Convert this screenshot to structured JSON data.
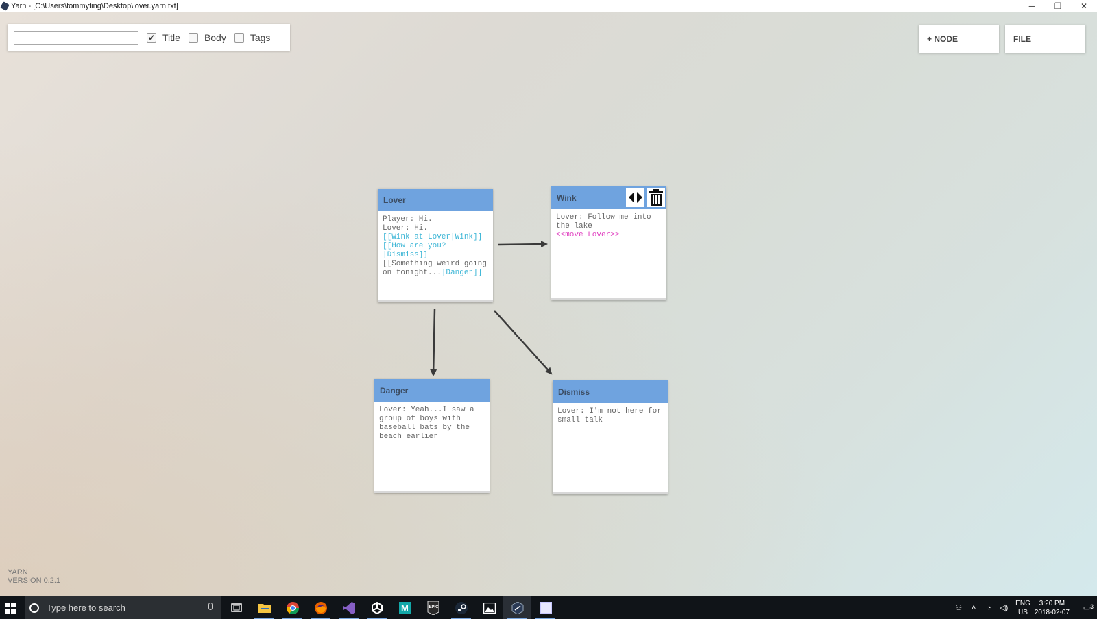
{
  "window": {
    "title": "Yarn - [C:\\Users\\tommyting\\Desktop\\lover.yarn.txt]",
    "minimize": "─",
    "restore": "❐",
    "close": "✕"
  },
  "search": {
    "value": "",
    "placeholder": "",
    "filters": [
      {
        "label": "Title",
        "checked": true
      },
      {
        "label": "Body",
        "checked": false
      },
      {
        "label": "Tags",
        "checked": false
      }
    ]
  },
  "toolbar": {
    "add_node_label": "+ NODE",
    "file_label": "FILE"
  },
  "nodes": {
    "lover": {
      "title": "Lover",
      "line1": "Player: Hi.",
      "line2": "Lover: Hi.",
      "link1_a": "[[Wink at Lover",
      "link1_b": "|Wink]]",
      "link2_a": "[[How are you?",
      "link2_b": "|Dismiss]]",
      "link3_a": "[[Something weird going on tonight...",
      "link3_b": "|Danger]]"
    },
    "wink": {
      "title": "Wink",
      "line1": "Lover: Follow me into the lake",
      "command": "<<move Lover>>"
    },
    "danger": {
      "title": "Danger",
      "line1": "Lover: Yeah...I saw a group of boys with baseball bats by the beach earlier"
    },
    "dismiss": {
      "title": "Dismiss",
      "line1": "Lover: I'm not here for small talk"
    }
  },
  "version": {
    "app": "YARN",
    "version": "VERSION 0.2.1"
  },
  "taskbar": {
    "search_placeholder": "Type here to search",
    "apps": [
      "file-explorer",
      "chrome",
      "firefox",
      "visual-studio",
      "unity",
      "maya",
      "epic-games",
      "steam",
      "photos",
      "yarn",
      "notepad"
    ],
    "lang_top": "ENG",
    "lang_bottom": "US",
    "time": "3:20 PM",
    "date": "2018-02-07",
    "notifications": "3"
  },
  "colors": {
    "node_header": "#6fa3df",
    "link": "#3db6d6",
    "command": "#e040c0"
  }
}
